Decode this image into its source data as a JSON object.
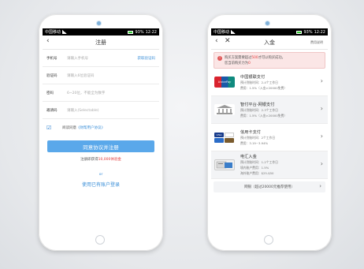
{
  "status_bar": {
    "carrier": "中国移动",
    "time": "12:22",
    "battery": "93%"
  },
  "register": {
    "title": "注册",
    "fields": [
      {
        "label": "手机号",
        "placeholder": "请输入手机号",
        "action": "获取验证码"
      },
      {
        "label": "验证码",
        "placeholder": "请输入6位验证码",
        "action": ""
      },
      {
        "label": "密码",
        "placeholder": "6~20位，不能全为数字",
        "action": ""
      },
      {
        "label": "邀请码",
        "placeholder": "请输入(Selectable)",
        "action": ""
      }
    ],
    "agree_text": "阅读同意",
    "agree_link": "《财帮用户协议》",
    "submit_label": "同意协议并注册",
    "promo_prefix": "注册即获得",
    "promo_amount": "10,000体验金",
    "or_text": "or",
    "login_link": "使用已有账户登录"
  },
  "deposit": {
    "title": "入金",
    "right_link": "费用说明",
    "notice_line1_prefix": "购买方案需要超过",
    "notice_line1_amount": "500",
    "notice_line1_suffix": "才可以购买成功。",
    "notice_line2_prefix": "您当前购买力为",
    "notice_line2_amount": "0",
    "methods": [
      {
        "name": "中国银联支付",
        "line1": "预计到账时间：2-4个工作日",
        "line2": "费用：1.5%（入金>20000免费）",
        "logo": "UnionPay"
      },
      {
        "name": "智付平台-网银支付",
        "line1": "预计到账时间：2-3个工作日",
        "line2": "费用：1.5%（入金>20000免费）",
        "logo": "bank-icon"
      },
      {
        "name": "信用卡支付",
        "line1": "预计到账时间：2个工作日",
        "line2": "费用：3.19~3.94%",
        "logo": "VISA"
      },
      {
        "name": "电汇入金",
        "line1": "预计到账时间：1-2个工作日",
        "line2": "境内账户费用：1.5%",
        "line3": "海外账户费用：$25-$50",
        "logo": "wire-icon"
      }
    ],
    "more_label": "网银（超过20000元推荐使用）"
  }
}
